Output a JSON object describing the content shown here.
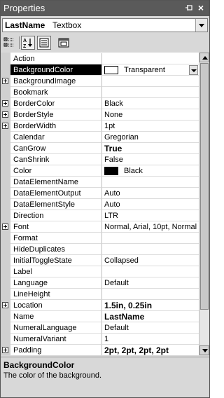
{
  "window": {
    "title": "Properties"
  },
  "object_selector": {
    "name": "LastName",
    "type": "Textbox"
  },
  "toolbar": {
    "buttons": [
      "categorized-icon",
      "alphabetical-icon",
      "property-pages-icon",
      "events-icon"
    ]
  },
  "properties": [
    {
      "name": "Action",
      "value": "",
      "expandable": false
    },
    {
      "name": "BackgroundColor",
      "value": "Transparent",
      "expandable": false,
      "selected": true,
      "swatch": "#ffffff",
      "dropdown": true
    },
    {
      "name": "BackgroundImage",
      "value": "",
      "expandable": true
    },
    {
      "name": "Bookmark",
      "value": "",
      "expandable": false
    },
    {
      "name": "BorderColor",
      "value": "Black",
      "expandable": true
    },
    {
      "name": "BorderStyle",
      "value": "None",
      "expandable": true
    },
    {
      "name": "BorderWidth",
      "value": "1pt",
      "expandable": true
    },
    {
      "name": "Calendar",
      "value": "Gregorian",
      "expandable": false
    },
    {
      "name": "CanGrow",
      "value": "True",
      "expandable": false,
      "bold": true
    },
    {
      "name": "CanShrink",
      "value": "False",
      "expandable": false
    },
    {
      "name": "Color",
      "value": "Black",
      "expandable": false,
      "swatch": "#000000"
    },
    {
      "name": "DataElementName",
      "value": "",
      "expandable": false
    },
    {
      "name": "DataElementOutput",
      "value": "Auto",
      "expandable": false
    },
    {
      "name": "DataElementStyle",
      "value": "Auto",
      "expandable": false
    },
    {
      "name": "Direction",
      "value": "LTR",
      "expandable": false
    },
    {
      "name": "Font",
      "value": "Normal, Arial, 10pt, Normal",
      "expandable": true
    },
    {
      "name": "Format",
      "value": "",
      "expandable": false
    },
    {
      "name": "HideDuplicates",
      "value": "",
      "expandable": false
    },
    {
      "name": "InitialToggleState",
      "value": "Collapsed",
      "expandable": false
    },
    {
      "name": "Label",
      "value": "",
      "expandable": false
    },
    {
      "name": "Language",
      "value": "Default",
      "expandable": false
    },
    {
      "name": "LineHeight",
      "value": "",
      "expandable": false
    },
    {
      "name": "Location",
      "value": "1.5in, 0.25in",
      "expandable": true,
      "bold": true
    },
    {
      "name": "Name",
      "value": "LastName",
      "expandable": false,
      "bold": true
    },
    {
      "name": "NumeralLanguage",
      "value": "Default",
      "expandable": false
    },
    {
      "name": "NumeralVariant",
      "value": "1",
      "expandable": false
    },
    {
      "name": "Padding",
      "value": "2pt, 2pt, 2pt, 2pt",
      "expandable": true,
      "bold": true
    }
  ],
  "description": {
    "title": "BackgroundColor",
    "text": "The color of the background."
  },
  "colors": {
    "titlebar": "#5a5a5a",
    "selection": "#000000",
    "panel": "#d8d8d8"
  }
}
